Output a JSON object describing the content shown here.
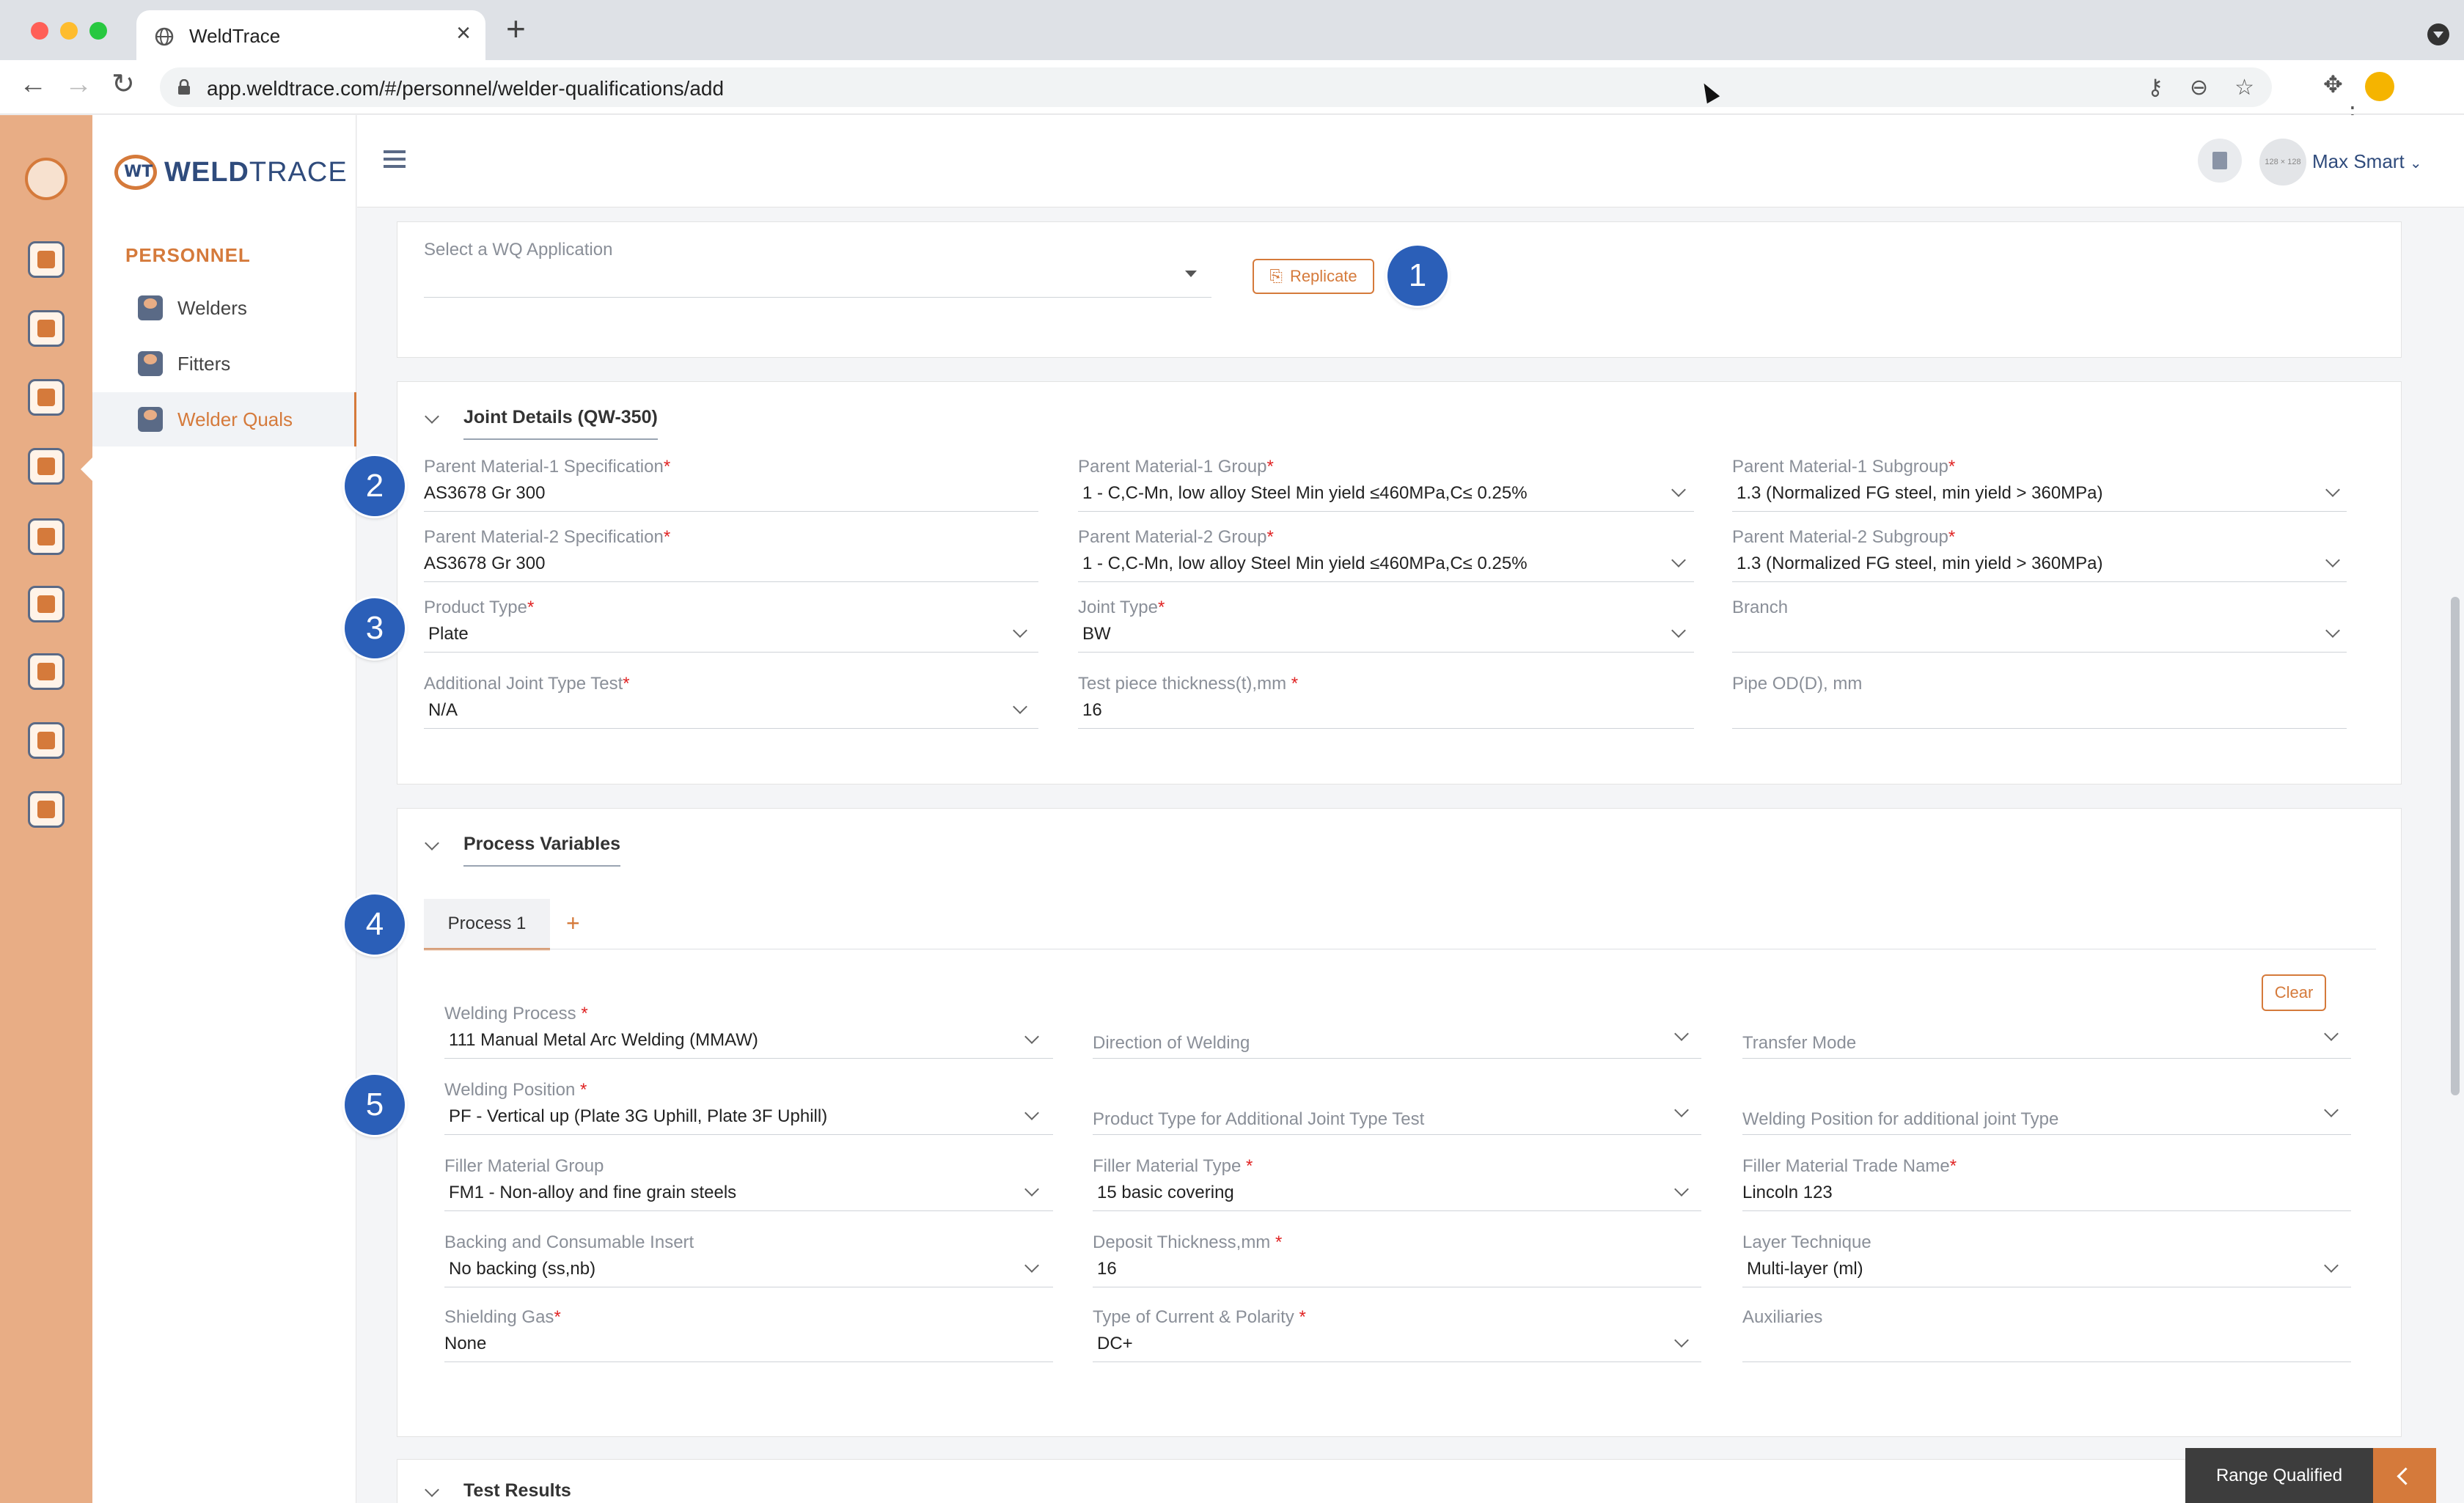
{
  "browser": {
    "tab_title": "WeldTrace",
    "url": "app.weldtrace.com/#/personnel/welder-qualifications/add"
  },
  "app": {
    "brand_prefix": "WELD",
    "brand_suffix": "TRACE",
    "accent_color": "#d57a3b",
    "brand_color": "#2f4b7c",
    "user_name": "Max Smart",
    "avatar_text": "128 × 128"
  },
  "sidebar": {
    "section": "PERSONNEL",
    "items": [
      {
        "label": "Welders"
      },
      {
        "label": "Fitters"
      },
      {
        "label": "Welder Quals"
      }
    ]
  },
  "application": {
    "select_placeholder": "Select a WQ Application",
    "replicate_label": "Replicate"
  },
  "badges": [
    "1",
    "2",
    "3",
    "4",
    "5"
  ],
  "joint": {
    "title": "Joint Details (QW-350)",
    "fields": {
      "pm1_spec": {
        "label": "Parent Material-1 Specification",
        "value": "AS3678 Gr 300"
      },
      "pm1_group": {
        "label": "Parent Material-1 Group",
        "value": "1 - C,C-Mn, low alloy Steel Min yield ≤460MPa,C≤ 0.25%"
      },
      "pm1_subgroup": {
        "label": "Parent Material-1 Subgroup",
        "value": "1.3 (Normalized FG steel, min yield > 360MPa)"
      },
      "pm2_spec": {
        "label": "Parent Material-2 Specification",
        "value": "AS3678 Gr 300"
      },
      "pm2_group": {
        "label": "Parent Material-2 Group",
        "value": "1 - C,C-Mn, low alloy Steel Min yield ≤460MPa,C≤ 0.25%"
      },
      "pm2_subgroup": {
        "label": "Parent Material-2 Subgroup",
        "value": "1.3 (Normalized FG steel, min yield > 360MPa)"
      },
      "product_type": {
        "label": "Product Type",
        "value": "Plate"
      },
      "joint_type": {
        "label": "Joint Type",
        "value": "BW"
      },
      "branch": {
        "label": "Branch",
        "value": ""
      },
      "add_joint_test": {
        "label": "Additional Joint Type Test",
        "value": "N/A"
      },
      "thickness": {
        "label": "Test piece thickness(t),mm ",
        "value": "16"
      },
      "pipe_od": {
        "label": "Pipe OD(D), mm",
        "value": ""
      }
    }
  },
  "process": {
    "title": "Process Variables",
    "tab_label": "Process 1",
    "add_symbol": "+",
    "clear_label": "Clear",
    "fields": {
      "welding_process": {
        "label": "Welding Process ",
        "value": "111 Manual Metal Arc Welding (MMAW)"
      },
      "direction": {
        "label": "Direction of Welding",
        "value": ""
      },
      "transfer_mode": {
        "label": "Transfer Mode",
        "value": ""
      },
      "welding_position": {
        "label": "Welding Position ",
        "value": "PF - Vertical up (Plate 3G Uphill, Plate 3F Uphill)"
      },
      "product_type_add": {
        "label": "Product Type for Additional Joint Type Test",
        "value": ""
      },
      "position_add": {
        "label": "Welding Position for additional joint Type",
        "value": ""
      },
      "filler_group": {
        "label": "Filler Material Group",
        "value": "FM1 - Non-alloy and fine grain steels"
      },
      "filler_type": {
        "label": "Filler Material Type ",
        "value": "15 basic covering"
      },
      "filler_trade": {
        "label": "Filler Material Trade Name",
        "value": "Lincoln 123"
      },
      "backing": {
        "label": "Backing and Consumable Insert",
        "value": "No backing (ss,nb)"
      },
      "deposit": {
        "label": "Deposit Thickness,mm ",
        "value": "16"
      },
      "layer": {
        "label": "Layer Technique",
        "value": "Multi-layer (ml)"
      },
      "shielding": {
        "label": "Shielding Gas",
        "value": "None"
      },
      "current": {
        "label": "Type of Current & Polarity ",
        "value": "DC+"
      },
      "auxiliaries": {
        "label": "Auxiliaries",
        "value": ""
      }
    }
  },
  "test_results": {
    "title": "Test Results"
  },
  "range_qualified": {
    "label": "Range Qualified"
  }
}
